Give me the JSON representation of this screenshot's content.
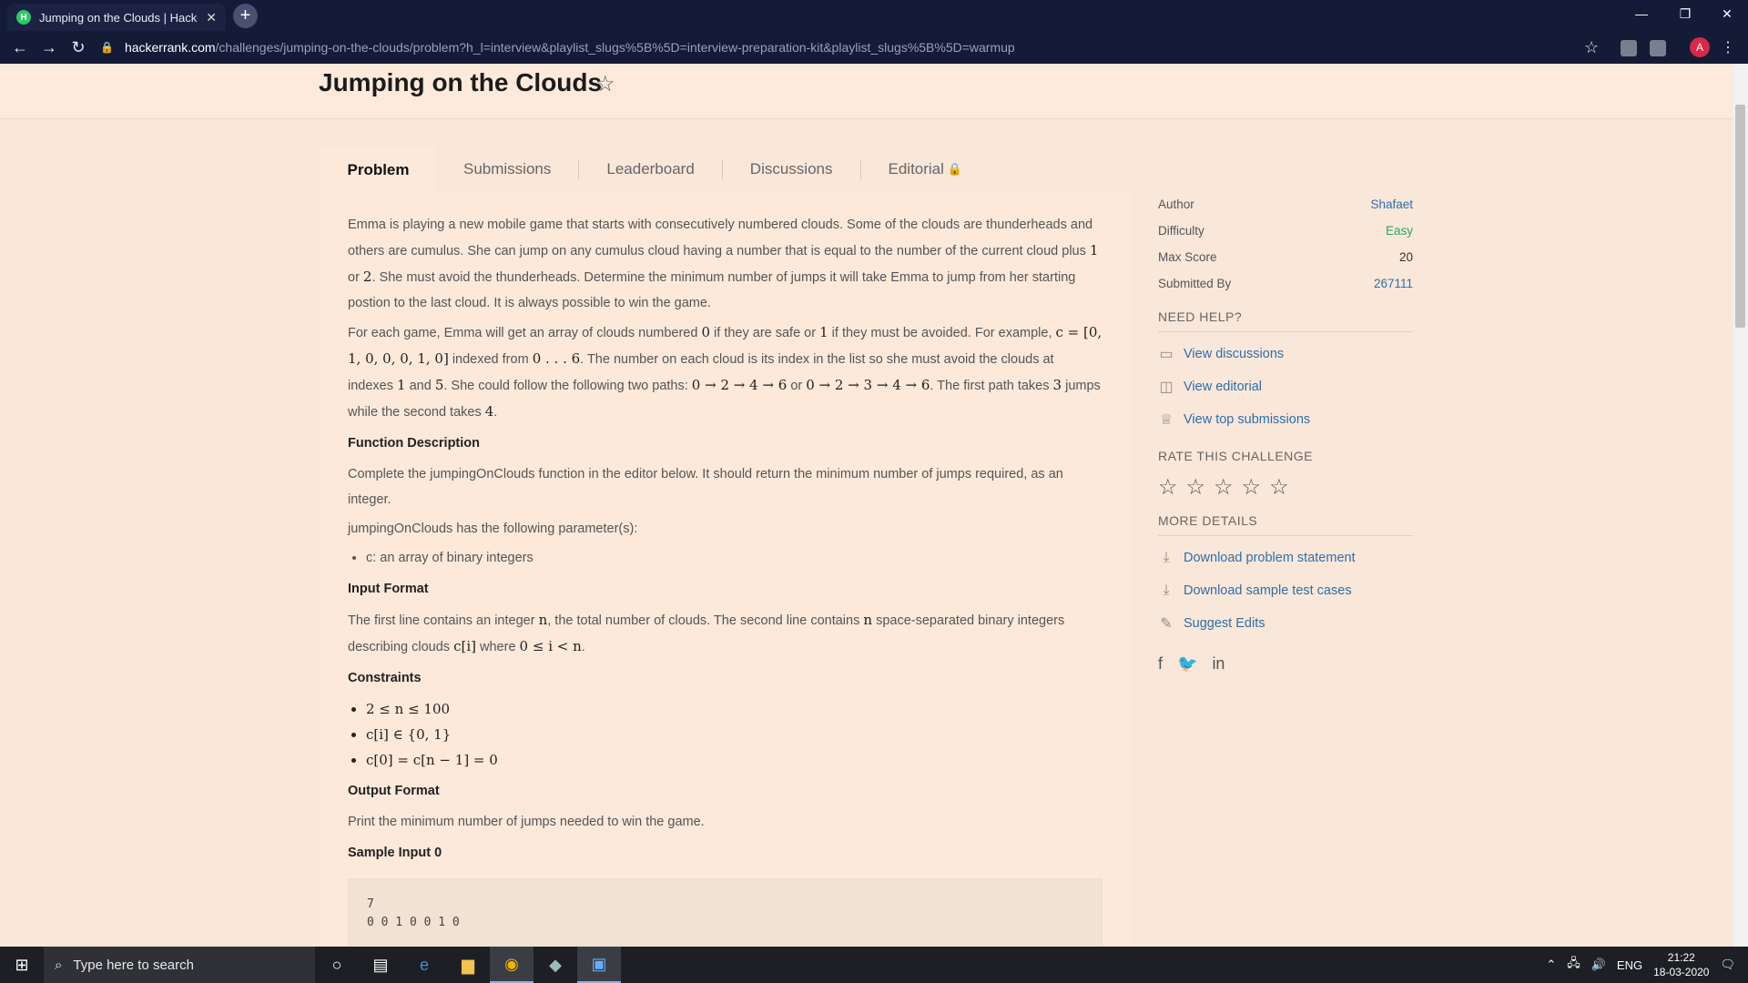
{
  "browser": {
    "tab_title": "Jumping on the Clouds | HackerRank",
    "favicon_letter": "H",
    "new_tab": "+",
    "url_host": "hackerrank.com",
    "url_rest": "/challenges/jumping-on-the-clouds/problem?h_l=interview&playlist_slugs%5B%5D=interview-preparation-kit&playlist_slugs%5B%5D=warmup",
    "profile_initial": "A"
  },
  "page": {
    "title": "Jumping on the Clouds",
    "tabs": [
      "Problem",
      "Submissions",
      "Leaderboard",
      "Discussions",
      "Editorial"
    ]
  },
  "problem": {
    "p1_a": "Emma is playing a new mobile game that starts with consecutively numbered clouds. Some of the clouds are thunderheads and others are cumulus. She can jump on any cumulus cloud having a number that is equal to the number of the current cloud plus ",
    "p1_m1": "1",
    "p1_b": " or ",
    "p1_m2": "2",
    "p1_c": ". She must avoid the thunderheads. Determine the minimum number of jumps it will take Emma to jump from her starting postion to the last cloud. It is always possible to win the game.",
    "p2_a": "For each game, Emma will get an array of clouds numbered ",
    "p2_m1": "0",
    "p2_b": " if they are safe or ",
    "p2_m2": "1",
    "p2_c": " if they must be avoided. For example, ",
    "p2_m3": "c = [0, 1, 0, 0, 0, 1, 0]",
    "p2_d": " indexed from ",
    "p2_m4": "0 . . . 6",
    "p2_e": ". The number on each cloud is its index in the list so she must avoid the clouds at indexes ",
    "p2_m5": "1",
    "p2_f": " and ",
    "p2_m6": "5",
    "p2_g": ". She could follow the following two paths: ",
    "p2_m7": "0 → 2 → 4 → 6",
    "p2_h": " or ",
    "p2_m8": "0 → 2 → 3 → 4 → 6",
    "p2_i": ". The first path takes ",
    "p2_m9": "3",
    "p2_j": " jumps while the second takes ",
    "p2_m10": "4",
    "p2_k": ".",
    "h_function": "Function Description",
    "function_desc": "Complete the jumpingOnClouds function in the editor below. It should return the minimum number of jumps required, as an integer.",
    "params_intro": "jumpingOnClouds has the following parameter(s):",
    "param_1": "c: an array of binary integers",
    "h_input": "Input Format",
    "in_a": "The first line contains an integer ",
    "in_m1": "n",
    "in_b": ", the total number of clouds. The second line contains ",
    "in_m2": "n",
    "in_c": " space-separated binary integers describing clouds ",
    "in_m3": "c[i]",
    "in_d": " where ",
    "in_m4": "0 ≤ i < n",
    "in_e": ".",
    "h_constraints": "Constraints",
    "constraints": [
      "2 ≤ n ≤ 100",
      "c[i] ∈ {0, 1}",
      "c[0] = c[n − 1] = 0"
    ],
    "h_output": "Output Format",
    "output_desc": "Print the minimum number of jumps needed to win the game.",
    "h_sample": "Sample Input 0",
    "sample_line1": "7",
    "sample_line2": "0 0 1 0 0 1 0"
  },
  "sidebar": {
    "author_label": "Author",
    "author": "Shafaet",
    "difficulty_label": "Difficulty",
    "difficulty": "Easy",
    "maxscore_label": "Max Score",
    "maxscore": "20",
    "submitted_label": "Submitted By",
    "submitted": "267111",
    "need_help": "NEED HELP?",
    "help_links": [
      "View discussions",
      "View editorial",
      "View top submissions"
    ],
    "rate": "RATE THIS CHALLENGE",
    "more": "MORE DETAILS",
    "more_links": [
      "Download problem statement",
      "Download sample test cases",
      "Suggest Edits"
    ]
  },
  "taskbar": {
    "search_placeholder": "Type here to search",
    "lang": "ENG",
    "time": "21:22",
    "date": "18-03-2020"
  }
}
